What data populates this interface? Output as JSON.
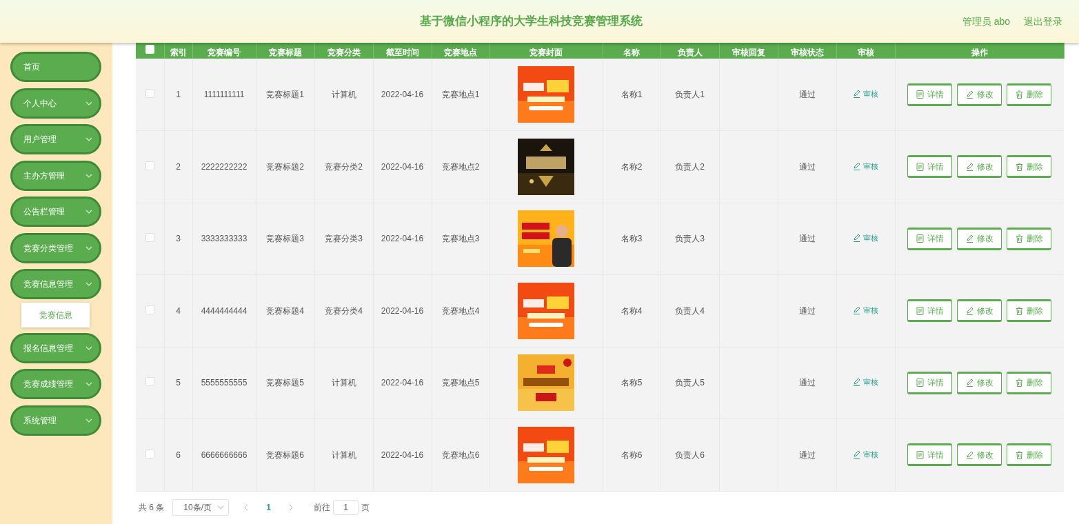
{
  "header": {
    "title": "基于微信小程序的大学生科技竞赛管理系统",
    "user": "管理员 abo",
    "logout": "退出登录"
  },
  "sidebar": {
    "items": [
      {
        "label": "首页",
        "has_submenu": false
      },
      {
        "label": "个人中心",
        "has_submenu": true
      },
      {
        "label": "用户管理",
        "has_submenu": true
      },
      {
        "label": "主办方管理",
        "has_submenu": true
      },
      {
        "label": "公告栏管理",
        "has_submenu": true
      },
      {
        "label": "竞赛分类管理",
        "has_submenu": true
      },
      {
        "label": "竞赛信息管理",
        "has_submenu": true,
        "children": [
          {
            "label": "竞赛信息",
            "selected": true
          }
        ]
      },
      {
        "label": "报名信息管理",
        "has_submenu": true
      },
      {
        "label": "竞赛成绩管理",
        "has_submenu": true
      },
      {
        "label": "系统管理",
        "has_submenu": true
      }
    ]
  },
  "table": {
    "select_all": {
      "checked": false
    },
    "columns": [
      "索引",
      "竞赛编号",
      "竞赛标题",
      "竞赛分类",
      "截至时间",
      "竞赛地点",
      "竞赛封面",
      "名称",
      "负责人",
      "审核回复",
      "审核状态",
      "审核",
      "操作"
    ],
    "rows": [
      {
        "checked": false,
        "index": "1",
        "number": "1111111111",
        "title": "竞赛标题1",
        "category": "计算机",
        "deadline": "2022-04-16",
        "place": "竞赛地点1",
        "name": "名称1",
        "owner": "负责人1",
        "status": "通过",
        "review": "审核",
        "actions": [
          "详情",
          "修改",
          "删除"
        ]
      },
      {
        "checked": false,
        "index": "2",
        "number": "2222222222",
        "title": "竞赛标题2",
        "category": "竞赛分类2",
        "deadline": "2022-04-16",
        "place": "竞赛地点2",
        "name": "名称2",
        "owner": "负责人2",
        "status": "通过",
        "review": "审核",
        "actions": [
          "详情",
          "修改",
          "删除"
        ]
      },
      {
        "checked": false,
        "index": "3",
        "number": "3333333333",
        "title": "竞赛标题3",
        "category": "竞赛分类3",
        "deadline": "2022-04-16",
        "place": "竞赛地点3",
        "name": "名称3",
        "owner": "负责人3",
        "status": "通过",
        "review": "审核",
        "actions": [
          "详情",
          "修改",
          "删除"
        ]
      },
      {
        "checked": false,
        "index": "4",
        "number": "4444444444",
        "title": "竞赛标题4",
        "category": "竞赛分类4",
        "deadline": "2022-04-16",
        "place": "竞赛地点4",
        "name": "名称4",
        "owner": "负责人4",
        "status": "通过",
        "review": "审核",
        "actions": [
          "详情",
          "修改",
          "删除"
        ]
      },
      {
        "checked": false,
        "index": "5",
        "number": "5555555555",
        "title": "竞赛标题5",
        "category": "计算机",
        "deadline": "2022-04-16",
        "place": "竞赛地点5",
        "name": "名称5",
        "owner": "负责人5",
        "status": "通过",
        "review": "审核",
        "actions": [
          "详情",
          "修改",
          "删除"
        ]
      },
      {
        "checked": false,
        "index": "6",
        "number": "6666666666",
        "title": "竞赛标题6",
        "category": "计算机",
        "deadline": "2022-04-16",
        "place": "竞赛地点6",
        "name": "名称6",
        "owner": "负责人6",
        "status": "通过",
        "review": "审核",
        "actions": [
          "详情",
          "修改",
          "删除"
        ]
      }
    ]
  },
  "pagination": {
    "total": "共 6 条",
    "page_size": "10条/页",
    "pages": [
      {
        "label": "1",
        "selected": true
      }
    ],
    "goto_label": "前往",
    "goto_value": "1",
    "goto_unit": "页"
  }
}
